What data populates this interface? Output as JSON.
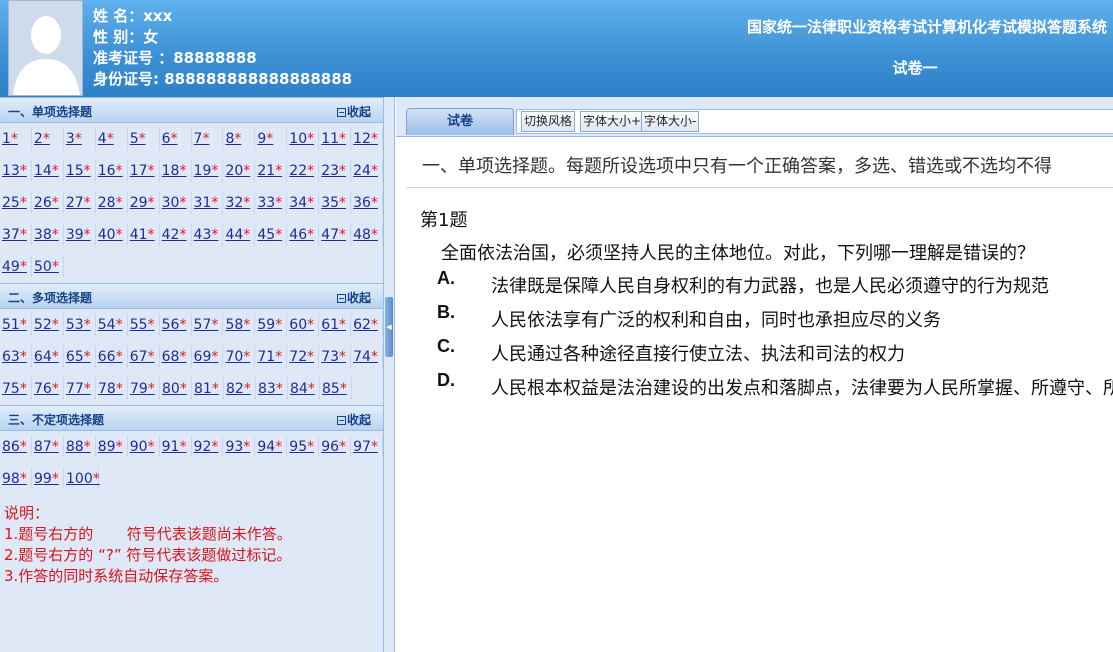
{
  "candidate": {
    "name": "姓 名：xxx",
    "gender": "性 别：女",
    "exam_no": "准考证号 ：88888888",
    "id_no": "身份证号: 888888888888888888"
  },
  "header": {
    "system_title": "国家统一法律职业资格考试计算机化考试模拟答题系统",
    "paper_title": "试卷一"
  },
  "sections": [
    {
      "title": "一、单项选择题",
      "collapse_label": "收起",
      "rows": [
        [
          "1",
          "2",
          "3",
          "4",
          "5",
          "6",
          "7",
          "8",
          "9",
          "10",
          "11",
          "12"
        ],
        [
          "13",
          "14",
          "15",
          "16",
          "17",
          "18",
          "19",
          "20",
          "21",
          "22",
          "23",
          "24"
        ],
        [
          "25",
          "26",
          "27",
          "28",
          "29",
          "30",
          "31",
          "32",
          "33",
          "34",
          "35",
          "36"
        ],
        [
          "37",
          "38",
          "39",
          "40",
          "41",
          "42",
          "43",
          "44",
          "45",
          "46",
          "47",
          "48"
        ],
        [
          "49",
          "50"
        ]
      ]
    },
    {
      "title": "二、多项选择题",
      "collapse_label": "收起",
      "rows": [
        [
          "51",
          "52",
          "53",
          "54",
          "55",
          "56",
          "57",
          "58",
          "59",
          "60",
          "61",
          "62"
        ],
        [
          "63",
          "64",
          "65",
          "66",
          "67",
          "68",
          "69",
          "70",
          "71",
          "72",
          "73",
          "74"
        ],
        [
          "75",
          "76",
          "77",
          "78",
          "79",
          "80",
          "81",
          "82",
          "83",
          "84",
          "85"
        ]
      ]
    },
    {
      "title": "三、不定项选择题",
      "collapse_label": "收起",
      "rows": [
        [
          "86",
          "87",
          "88",
          "89",
          "90",
          "91",
          "92",
          "93",
          "94",
          "95",
          "96",
          "97"
        ],
        [
          "98",
          "99",
          "100"
        ]
      ]
    }
  ],
  "unanswered_mark": "*",
  "notes": {
    "heading": "说明：",
    "line1": "1.题号右方的       符号代表该题尚未作答。",
    "line2": "2.题号右方的 “?” 符号代表该题做过标记。",
    "line3": "3.作答的同时系统自动保存答案。"
  },
  "toolbar": {
    "tab_label": "试卷",
    "switch_style": "切换风格",
    "font_bigger": "字体大小+",
    "font_smaller": "字体大小-"
  },
  "question": {
    "instruction": "一、单项选择题。每题所设选项中只有一个正确答案，多选、错选或不选均不得",
    "number_label": "第1题",
    "stem": "全面依法治国，必须坚持人民的主体地位。对此，下列哪一理解是错误的？",
    "options": [
      {
        "label": "A.",
        "text": "法律既是保障人民自身权利的有力武器，也是人民必须遵守的行为规范"
      },
      {
        "label": "B.",
        "text": "人民依法享有广泛的权利和自由，同时也承担应尽的义务"
      },
      {
        "label": "C.",
        "text": "人民通过各种途径直接行使立法、执法和司法的权力"
      },
      {
        "label": "D.",
        "text": "人民根本权益是法治建设的出发点和落脚点，法律要为人民所掌握、所遵守、所运用"
      }
    ]
  },
  "colors": {
    "header_blue": "#3b8fd3",
    "link_blue": "#1f2b9b",
    "mark_red": "#e0192b",
    "note_red": "#d8141c"
  }
}
